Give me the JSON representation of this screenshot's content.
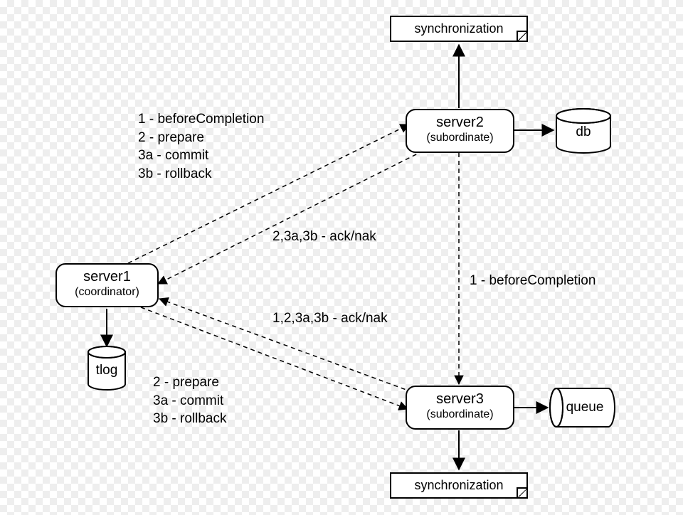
{
  "nodes": {
    "server1": {
      "title": "server1",
      "sub": "(coordinator)"
    },
    "server2": {
      "title": "server2",
      "sub": "(subordinate)"
    },
    "server3": {
      "title": "server3",
      "sub": "(subordinate)"
    }
  },
  "stores": {
    "tlog": "tlog",
    "db": "db",
    "queue": "queue"
  },
  "notes": {
    "syncTop": "synchronization",
    "syncBottom": "synchronization"
  },
  "labels": {
    "s1_to_s2": "1 - beforeCompletion\n2 - prepare\n3a - commit\n3b - rollback",
    "s2_to_s1": "2,3a,3b - ack/nak",
    "s1_to_s3_ack": "1,2,3a,3b - ack/nak",
    "s2_to_s3": "1 - beforeCompletion",
    "s1_to_s3_cmds": "2 - prepare\n3a - commit\n3b - rollback"
  }
}
